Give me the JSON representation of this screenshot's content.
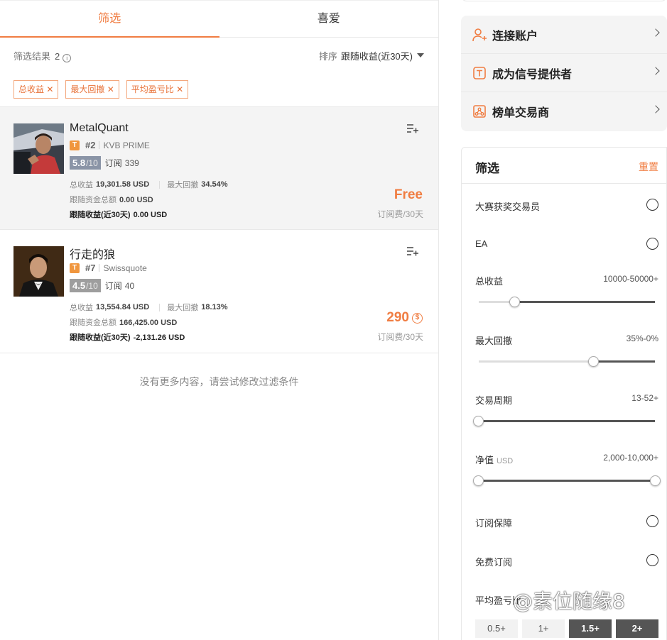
{
  "tabs": [
    {
      "label": "筛选",
      "active": true
    },
    {
      "label": "喜爱",
      "active": false
    }
  ],
  "results": {
    "label": "筛选结果",
    "count": "2",
    "sort_label": "排序",
    "sort_value": "跟随收益(近30天)"
  },
  "chips": [
    "总收益 ✕",
    "最大回撤 ✕",
    "平均盈亏比 ✕"
  ],
  "traders": [
    {
      "name": "MetalQuant",
      "badge": "T",
      "rank": "#2",
      "broker": "KVB PRIME",
      "score": "5.8",
      "score_of": "/10",
      "subs_label": "订阅",
      "subs": "339",
      "total_profit_label": "总收益",
      "total_profit": "19,301.58 USD",
      "drawdown_label": "最大回撤",
      "drawdown": "34.54%",
      "follow_funds_label": "跟随资金总额",
      "follow_funds": "0.00 USD",
      "follow_profit_label": "跟随收益(近30天)",
      "follow_profit": "0.00 USD",
      "price": "Free",
      "price_unit": "订阅费/30天",
      "score_color": "#8a94a6"
    },
    {
      "name": "行走的狼",
      "badge": "T",
      "rank": "#7",
      "broker": "Swissquote",
      "score": "4.5",
      "score_of": "/10",
      "subs_label": "订阅",
      "subs": "40",
      "total_profit_label": "总收益",
      "total_profit": "13,554.84 USD",
      "drawdown_label": "最大回撤",
      "drawdown": "18.13%",
      "follow_funds_label": "跟随资金总额",
      "follow_funds": "166,425.00 USD",
      "follow_profit_label": "跟随收益(近30天)",
      "follow_profit": "-2,131.26 USD",
      "price": "290",
      "price_unit": "订阅费/30天",
      "score_color": "#9e9e9e"
    }
  ],
  "no_more_text": "没有更多内容，请尝试修改过滤条件",
  "menu": [
    {
      "label": "连接账户",
      "icon": "add-user-icon"
    },
    {
      "label": "成为信号提供者",
      "icon": "t-box-icon"
    },
    {
      "label": "榜单交易商",
      "icon": "network-icon"
    }
  ],
  "filter_panel": {
    "title": "筛选",
    "reset": "重置",
    "award_label": "大赛获奖交易员",
    "ea_label": "EA",
    "total_profit": {
      "label": "总收益",
      "value": "10000-50000+",
      "low": 0.2
    },
    "drawdown": {
      "label": "最大回撤",
      "value": "35%-0%",
      "low": 0.65
    },
    "period": {
      "label": "交易周期",
      "value": "13-52+",
      "low": 0.0
    },
    "equity": {
      "label": "净值",
      "unit": "USD",
      "value": "2,000-10,000+",
      "low": 0.0,
      "high": 1.0
    },
    "guarantee_label": "订阅保障",
    "free_label": "免费订阅",
    "avg_label": "平均盈亏比",
    "pills": [
      {
        "label": "0.5+",
        "on": false
      },
      {
        "label": "1+",
        "on": false
      },
      {
        "label": "1.5+",
        "on": true
      },
      {
        "label": "2+",
        "on": true
      }
    ]
  },
  "watermark": "@素位随缘8",
  "colors": {
    "accent": "#f07d42"
  }
}
